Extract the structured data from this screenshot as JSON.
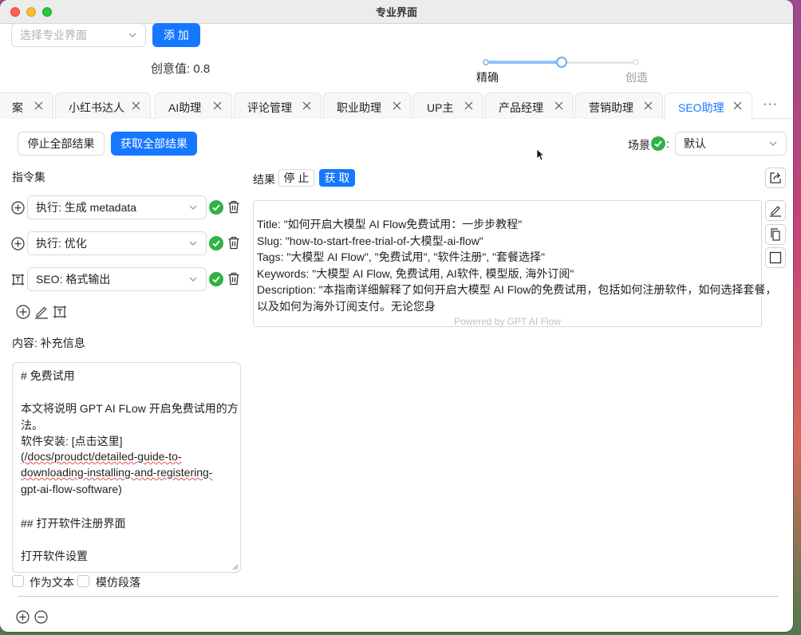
{
  "window": {
    "title": "专业界面"
  },
  "toolbar": {
    "select_placeholder": "选择专业界面",
    "add_label": "添 加",
    "creativity_label": "创意值: 0.8",
    "slider": {
      "value": 0.8,
      "min_label": "精确",
      "max_label": "创造"
    }
  },
  "tabs": [
    {
      "label": "案",
      "active": false
    },
    {
      "label": "小红书达人",
      "active": false
    },
    {
      "label": "AI助理",
      "active": false
    },
    {
      "label": "评论管理",
      "active": false
    },
    {
      "label": "职业助理",
      "active": false
    },
    {
      "label": "UP主",
      "active": false
    },
    {
      "label": "产品经理",
      "active": false
    },
    {
      "label": "营销助理",
      "active": false
    },
    {
      "label": "SEO助理",
      "active": true
    }
  ],
  "tabs_more": "···",
  "actions": {
    "stop_all": "停止全部结果",
    "get_all": "获取全部结果",
    "scene_label": "场景",
    "scene_colon": ":",
    "scene_value": "默认"
  },
  "instructions": {
    "title": "指令集",
    "items": [
      {
        "label": "执行: 生成 metadata",
        "icon": "plus-circle-icon",
        "status": "check-icon"
      },
      {
        "label": "执行: 优化",
        "icon": "plus-circle-icon",
        "status": "check-icon"
      },
      {
        "label": "SEO: 格式输出",
        "icon": "format-icon",
        "status": "check-icon"
      }
    ]
  },
  "content": {
    "label": "内容: 补充信息",
    "lines": [
      "# 免费试用",
      "",
      "本文将说明 GPT AI FLow 开启免费试用的方",
      "法。",
      "软件安装: [点击这里]",
      "(/docs/proudct/detailed-guide-to-",
      "downloading-installing-and-registering-",
      "gpt-ai-flow-software)",
      "",
      "## 打开软件注册界面",
      "",
      "打开软件设置"
    ],
    "as_text": "作为文本",
    "mimic_paragraph": "模仿段落"
  },
  "result": {
    "label": "结果",
    "stop": "停 止",
    "get": "获 取",
    "lines": [
      "Title: \"如何开启大模型 AI Flow免费试用：一步步教程\"",
      "Slug: \"how-to-start-free-trial-of-大模型-ai-flow\"",
      "Tags: \"大模型 AI Flow\", \"免费试用\", \"软件注册\", \"套餐选择\"",
      "Keywords: \"大模型 AI Flow, 免费试用, AI软件, 模型版, 海外订阅\"",
      "Description: \"本指南详细解释了如何开启大模型 AI Flow的免费试用，包括如何注册软件，如何选择套餐，",
      "以及如何为海外订阅支付。无论您身"
    ],
    "powered": "Powered by GPT AI Flow"
  },
  "colors": {
    "primary": "#1677ff",
    "success": "#2fb344"
  }
}
